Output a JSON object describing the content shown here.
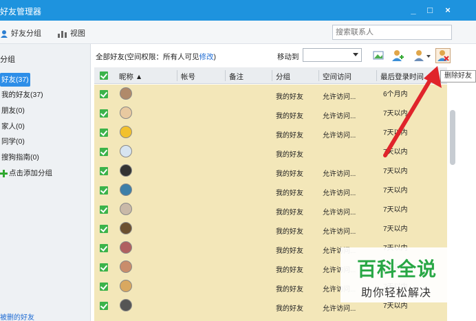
{
  "window": {
    "title": "好友管理器",
    "minimize": "_",
    "maximize": "□",
    "close": "×"
  },
  "toolbar": {
    "group_view": "好友分组",
    "view": "视图",
    "search_placeholder": "搜索联系人"
  },
  "sidebar": {
    "title": "分组",
    "groups": [
      {
        "label": "好友(37)",
        "selected": true
      },
      {
        "label": "我的好友(37)"
      },
      {
        "label": "朋友(0)"
      },
      {
        "label": "家人(0)"
      },
      {
        "label": "同学(0)"
      },
      {
        "label": "搜狗指南(0)"
      }
    ],
    "add_group": "点击添加分组",
    "deleted_friends": "被删的好友"
  },
  "main": {
    "info_prefix": "全部好友(空间权限：所有人可见",
    "info_modify": "修改",
    "info_suffix": ")",
    "move_to": "移动到",
    "move_select_value": ""
  },
  "tooltip": {
    "delete_friend": "删除好友"
  },
  "table": {
    "headers": {
      "nickname": "昵称",
      "account": "帐号",
      "note": "备注",
      "group": "分组",
      "space": "空间访问",
      "last_login": "最后登录时间"
    },
    "rows": [
      {
        "group": "我的好友",
        "space": "允许访问...",
        "last": "6个月内",
        "color": "#b08a6a"
      },
      {
        "group": "我的好友",
        "space": "允许访问...",
        "last": "7天以内",
        "color": "#e8c9a0"
      },
      {
        "group": "我的好友",
        "space": "允许访问...",
        "last": "7天以内",
        "color": "#f2c12e"
      },
      {
        "group": "我的好友",
        "space": "",
        "last": "7天以内",
        "color": "#d7e4f0"
      },
      {
        "group": "我的好友",
        "space": "允许访问...",
        "last": "7天以内",
        "color": "#333333"
      },
      {
        "group": "我的好友",
        "space": "允许访问...",
        "last": "7天以内",
        "color": "#3d7fa8"
      },
      {
        "group": "我的好友",
        "space": "允许访问...",
        "last": "7天以内",
        "color": "#c9b9a8"
      },
      {
        "group": "我的好友",
        "space": "允许访问...",
        "last": "7天以内",
        "color": "#6b5030"
      },
      {
        "group": "我的好友",
        "space": "允许访问...",
        "last": "7天以内",
        "color": "#b06060"
      },
      {
        "group": "我的好友",
        "space": "允许访问...",
        "last": "7天以内",
        "color": "#c98d6b"
      },
      {
        "group": "我的好友",
        "space": "允许访问...",
        "last": "7天以内",
        "color": "#d9a860"
      },
      {
        "group": "我的好友",
        "space": "允许访问...",
        "last": "7天以内",
        "color": "#555555"
      }
    ]
  },
  "watermark": {
    "title": "百科全说",
    "subtitle": "助你轻松解决"
  },
  "colors": {
    "titlebar": "#1e93de",
    "row_bg": "#f3e7b9",
    "checkbox": "#3bb34a",
    "arrow": "#e0242b",
    "watermark": "#28a745"
  }
}
